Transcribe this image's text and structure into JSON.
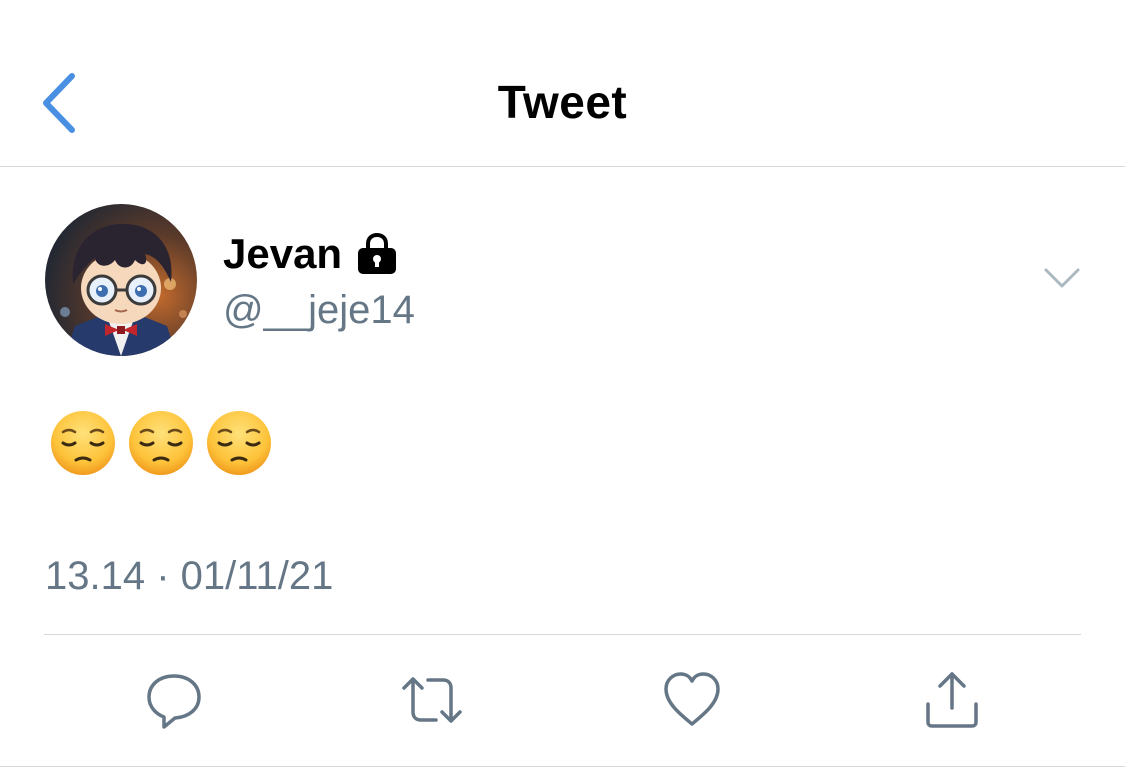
{
  "nav": {
    "title": "Tweet",
    "back_icon": "chevron-left-icon"
  },
  "tweet": {
    "display_name": "Jevan",
    "protected_icon": "lock-icon",
    "handle": "@__jeje14",
    "body_emoji": [
      "pensive-face",
      "pensive-face",
      "pensive-face"
    ],
    "timestamp": "13.14 · 01/11/21",
    "menu_icon": "chevron-down-icon"
  },
  "actions": [
    {
      "name": "reply",
      "icon": "comment-icon"
    },
    {
      "name": "retweet",
      "icon": "retweet-icon"
    },
    {
      "name": "like",
      "icon": "heart-icon"
    },
    {
      "name": "share",
      "icon": "share-icon"
    }
  ],
  "colors": {
    "accent": "#1da1f2",
    "back_arrow": "#4a90e2",
    "secondary_text": "#657786",
    "divider": "#d5d9dc",
    "icon_gray": "#657786"
  }
}
